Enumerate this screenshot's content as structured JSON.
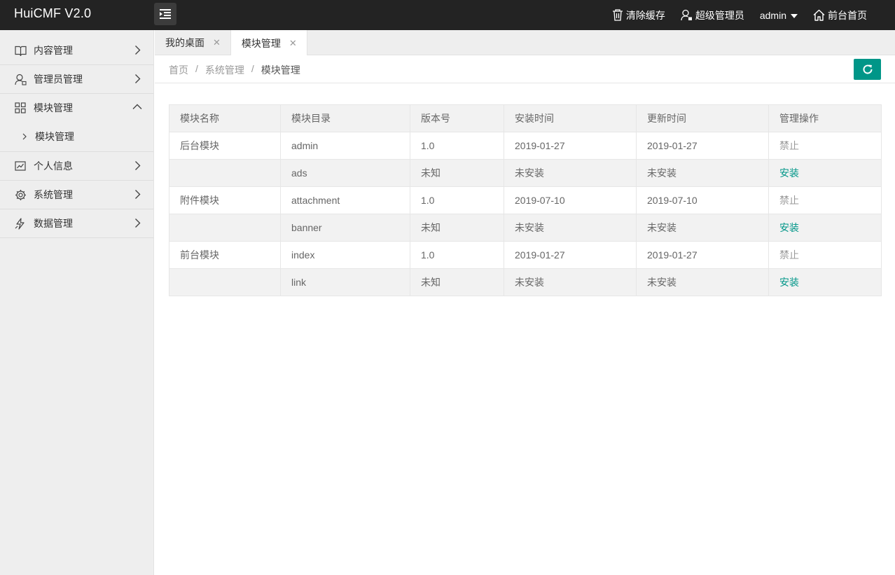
{
  "app": {
    "title": "HuiCMF V2.0"
  },
  "topbar": {
    "clear_cache": "清除缓存",
    "role": "超级管理员",
    "user": "admin",
    "frontend_home": "前台首页"
  },
  "sidebar": {
    "items": [
      {
        "label": "内容管理",
        "icon": "book-icon",
        "expanded": false
      },
      {
        "label": "管理员管理",
        "icon": "user-icon",
        "expanded": false
      },
      {
        "label": "模块管理",
        "icon": "grid-icon",
        "expanded": true,
        "children": [
          {
            "label": "模块管理"
          }
        ]
      },
      {
        "label": "个人信息",
        "icon": "chart-icon",
        "expanded": false
      },
      {
        "label": "系统管理",
        "icon": "gear-icon",
        "expanded": false
      },
      {
        "label": "数据管理",
        "icon": "data-icon",
        "expanded": false
      }
    ]
  },
  "tabs": [
    {
      "label": "我的桌面",
      "active": false
    },
    {
      "label": "模块管理",
      "active": true
    }
  ],
  "breadcrumb": {
    "items": [
      "首页",
      "系统管理"
    ],
    "separator": "/",
    "current": "模块管理"
  },
  "table": {
    "headers": [
      "模块名称",
      "模块目录",
      "版本号",
      "安装时间",
      "更新时间",
      "管理操作"
    ],
    "rows": [
      {
        "name": "后台模块",
        "dir": "admin",
        "version": "1.0",
        "installed": "2019-01-27",
        "updated": "2019-01-27",
        "action": "禁止",
        "action_type": "disabled"
      },
      {
        "name": "",
        "dir": "ads",
        "version": "未知",
        "installed": "未安装",
        "updated": "未安装",
        "action": "安装",
        "action_type": "install"
      },
      {
        "name": "附件模块",
        "dir": "attachment",
        "version": "1.0",
        "installed": "2019-07-10",
        "updated": "2019-07-10",
        "action": "禁止",
        "action_type": "disabled"
      },
      {
        "name": "",
        "dir": "banner",
        "version": "未知",
        "installed": "未安装",
        "updated": "未安装",
        "action": "安装",
        "action_type": "install"
      },
      {
        "name": "前台模块",
        "dir": "index",
        "version": "1.0",
        "installed": "2019-01-27",
        "updated": "2019-01-27",
        "action": "禁止",
        "action_type": "disabled"
      },
      {
        "name": "",
        "dir": "link",
        "version": "未知",
        "installed": "未安装",
        "updated": "未安装",
        "action": "安装",
        "action_type": "install"
      }
    ]
  },
  "colors": {
    "topbar_bg": "#232323",
    "sidebar_bg": "#eeeeee",
    "accent": "#009688"
  }
}
